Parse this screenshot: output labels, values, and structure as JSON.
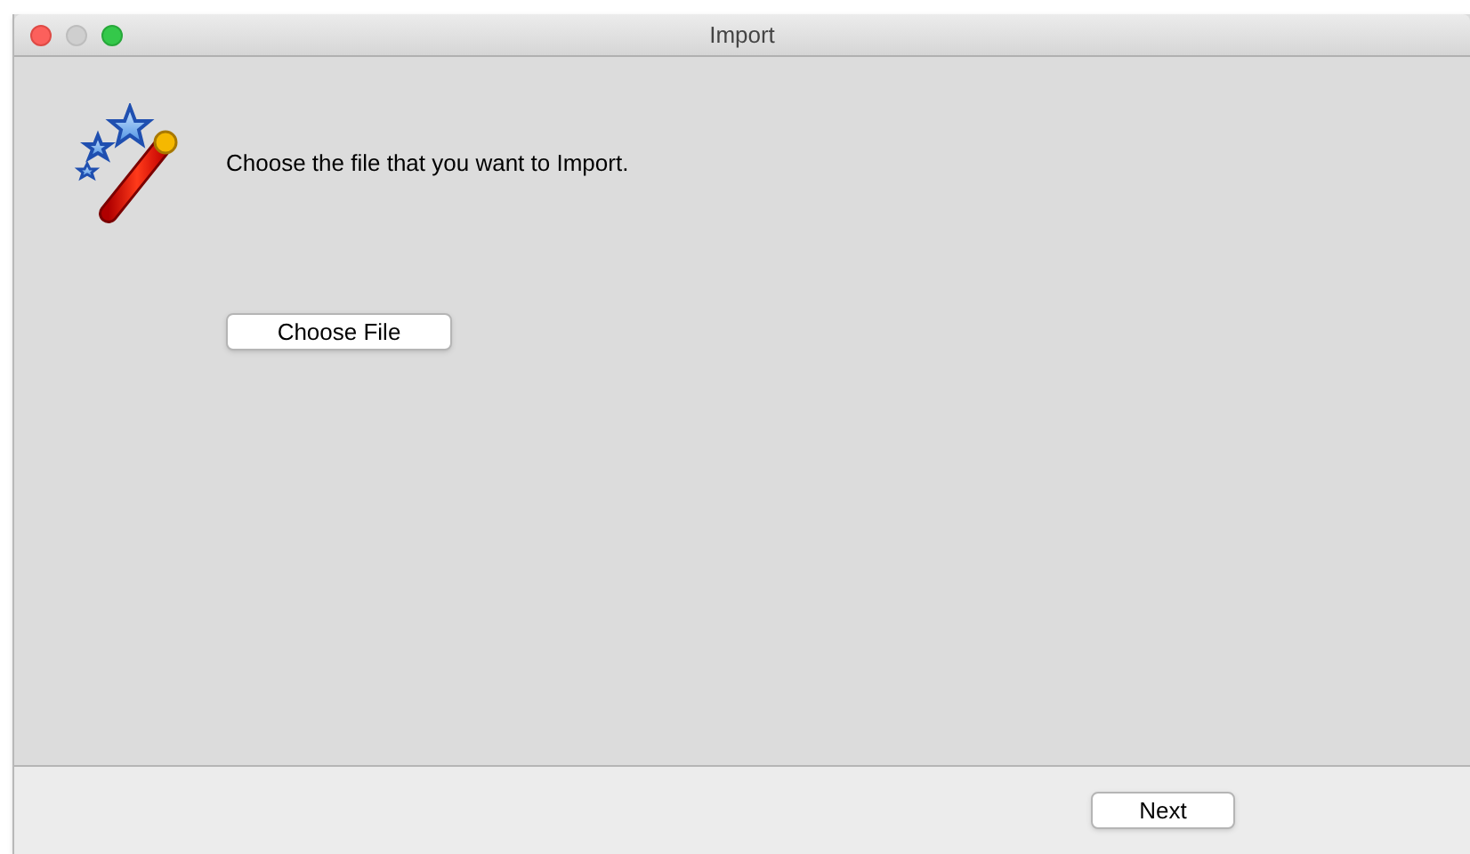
{
  "window": {
    "title": "Import"
  },
  "prompt": "Choose the file that you want to Import.",
  "choose_button": "Choose File",
  "footer": {
    "next_button": "Next"
  }
}
